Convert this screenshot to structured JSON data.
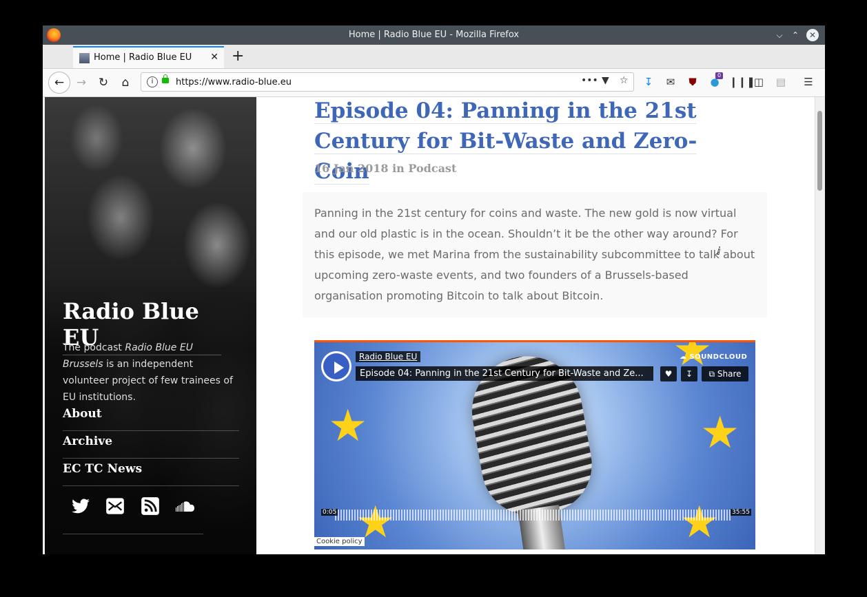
{
  "window": {
    "title": "Home | Radio Blue EU - Mozilla Firefox"
  },
  "tabs": [
    {
      "label": "Home | Radio Blue EU"
    }
  ],
  "urlbar": {
    "url": "https://www.radio-blue.eu"
  },
  "toolbar": {
    "badge_count": "0"
  },
  "sidebar": {
    "site_title": "Radio Blue EU",
    "desc_prefix": "The podcast ",
    "desc_em": "Radio Blue EU Brussels",
    "desc_suffix": " is an independent volunteer project of few trainees of EU institutions.",
    "nav": [
      {
        "label": "About"
      },
      {
        "label": "Archive"
      },
      {
        "label": "EC TC News"
      }
    ],
    "social_icons": [
      "twitter-icon",
      "mail-icon",
      "rss-icon",
      "soundcloud-icon"
    ]
  },
  "post": {
    "title": "Episode 04: Panning in the 21st Century for Bit-Waste and Zero-Coin",
    "title_line1": "Episode 04: Panning in the 21st",
    "title_line2": "Century for Bit-Waste and Zero-Coin",
    "meta": "16 Jan 2018 in Podcast",
    "lead": "Panning in the 21st century for coins and waste. The new gold is now virtual and our old plastic is in the ocean. Shouldn’t it be the other way around? For this episode, we met Marina from the sustainability subcommittee to talk about upcoming zero-waste events, and two founders of a Brussels-based organisation promoting Bitcoin to talk about Bitcoin."
  },
  "player": {
    "user": "Radio Blue EU",
    "track": "Episode 04: Panning in the 21st Century for Bit-Waste and Ze...",
    "brand": "SOUNDCLOUD",
    "share_label": "Share",
    "time_current": "0:05",
    "time_total": "35:55",
    "cookie": "Cookie policy",
    "accent_color": "#ff5500"
  }
}
